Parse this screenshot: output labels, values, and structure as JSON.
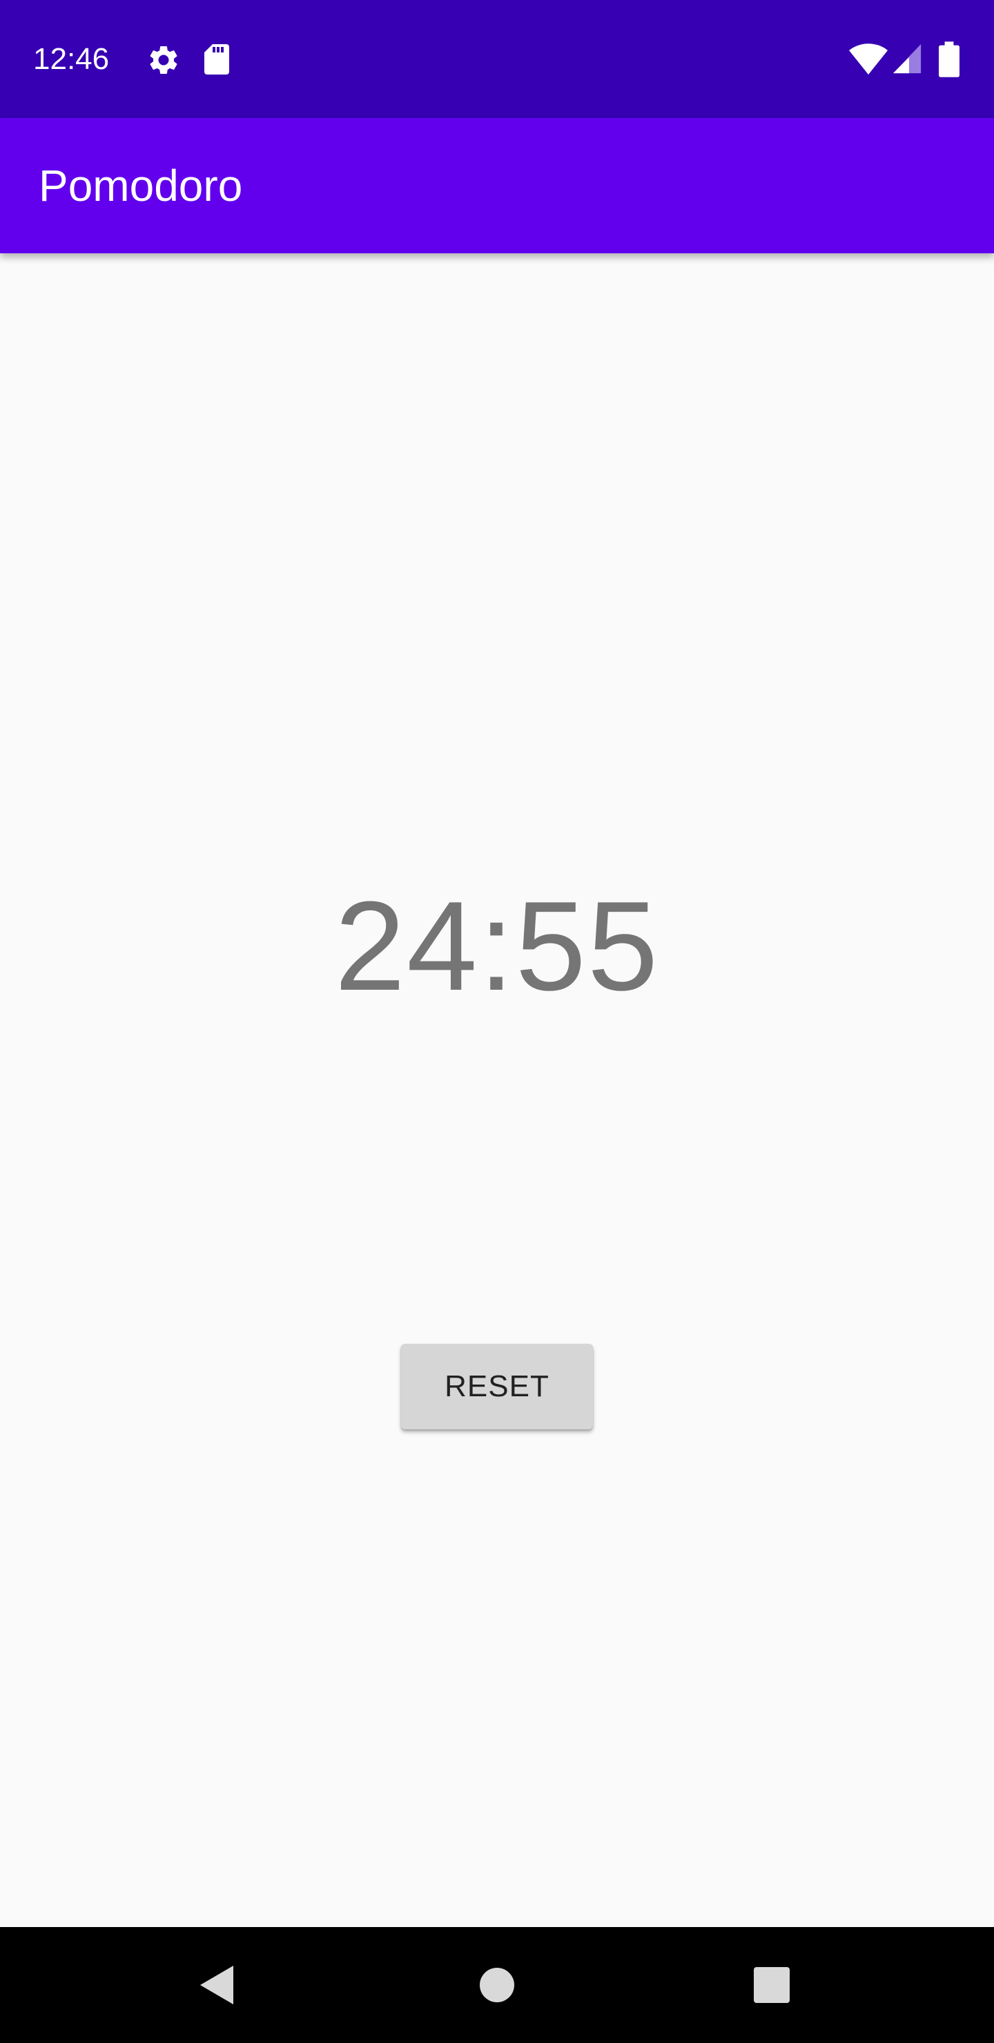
{
  "status_bar": {
    "time": "12:46",
    "background_color": "#3700B3",
    "left_icons": [
      "gear-icon",
      "sd-card-icon"
    ],
    "right_icons": [
      "wifi-icon",
      "cell-signal-icon",
      "battery-icon"
    ]
  },
  "app_bar": {
    "title": "Pomodoro",
    "background_color": "#6200EE"
  },
  "timer": {
    "display": "24:55",
    "color": "#757575"
  },
  "reset_button": {
    "label": "RESET",
    "background_color": "#D6D6D6"
  },
  "nav_bar": {
    "buttons": [
      "back-icon",
      "home-icon",
      "recents-icon"
    ],
    "background_color": "#000000"
  }
}
